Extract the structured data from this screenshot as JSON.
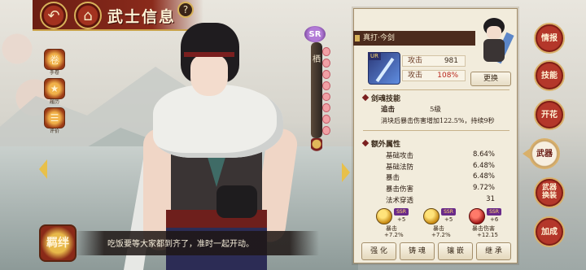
{
  "header": {
    "title": "武士信息",
    "back_icon": "back-arrow-icon",
    "home_icon": "castle-home-icon",
    "help_label": "?"
  },
  "left_menu": [
    {
      "icon": "scroll-icon",
      "label": "手卷"
    },
    {
      "icon": "star-medal-icon",
      "label": "履历"
    },
    {
      "icon": "document-icon",
      "label": "评价"
    }
  ],
  "character": {
    "rarity": "SR",
    "scroll_text": "栖",
    "dialogue": "吃饭要等大家都到齐了，准时一起开动。",
    "bond_button": "羁绊"
  },
  "panel": {
    "name": "真打·今剑",
    "weapon": {
      "tier": "UR",
      "stats": [
        {
          "label": "攻击",
          "value": "981",
          "red": false
        },
        {
          "label": "攻击",
          "value": "108%",
          "red": true
        }
      ],
      "change_label": "更换"
    },
    "skill_section": {
      "title": "剑魂技能",
      "name": "追击",
      "level": "5级",
      "desc": "消块后暴击伤害增加122.5%，持续9秒"
    },
    "extra_section": {
      "title": "额外属性",
      "rows": [
        {
          "label": "基础攻击",
          "value": "8.64%"
        },
        {
          "label": "基础法防",
          "value": "6.48%"
        },
        {
          "label": "暴击",
          "value": "6.48%"
        },
        {
          "label": "暴击伤害",
          "value": "9.72%"
        },
        {
          "label": "法术穿透",
          "value": "31"
        }
      ]
    },
    "gems": [
      {
        "grade": "SSR",
        "level": "+5",
        "stat": "暴击",
        "bonus": "+7.2%",
        "color": "#d9a22a"
      },
      {
        "grade": "SSR",
        "level": "+5",
        "stat": "暴击",
        "bonus": "+7.2%",
        "color": "#d9a22a"
      },
      {
        "grade": "SSR",
        "level": "+6",
        "stat": "暴击伤害",
        "bonus": "+12.15",
        "color": "#c0241a"
      }
    ],
    "actions": [
      "强 化",
      "铸 魂",
      "镶 嵌",
      "继 承"
    ]
  },
  "right_tabs": [
    {
      "label": "情报",
      "active": false
    },
    {
      "label": "技能",
      "active": false
    },
    {
      "label": "开花",
      "active": false
    },
    {
      "label": "武器",
      "active": true
    },
    {
      "label": "武器换装",
      "active": false
    },
    {
      "label": "加成",
      "active": false
    }
  ]
}
